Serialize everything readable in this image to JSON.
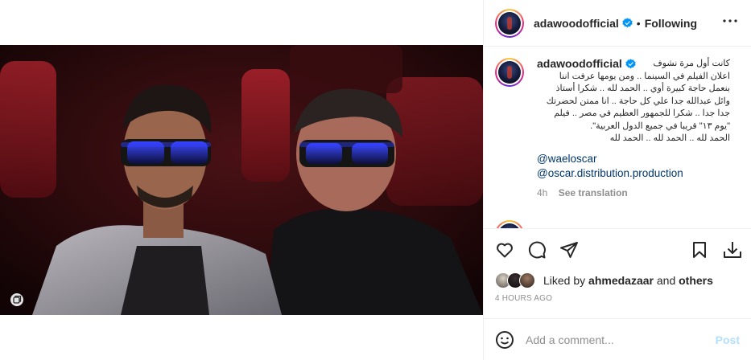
{
  "post": {
    "username": "adawoodofficial",
    "follow_status": "Following",
    "separator": "•"
  },
  "caption": {
    "username": "adawoodofficial",
    "lines": [
      "كانت أول مرة نشوف",
      "اعلان الفيلم في السينما .. ومن يومها عرفت اننا",
      "بنعمل حاجة كبيرة أوي .. الحمد لله .. شكرا أستاذ",
      "وائل عبدالله جدا علي كل حاجة .. انا ممتن لحضرتك",
      "جدا جدا .. شكرا للجمهور العظيم في مصر .. فيلم",
      "\"يوم ١٣\" قريبا في جميع الدول العربية\".",
      "الحمد لله .. الحمد لله .. الحمد لله"
    ],
    "mentions": [
      "@waeloscar",
      "@oscar.distribution.production"
    ],
    "age": "4h",
    "see_translation": "See translation"
  },
  "likes": {
    "prefix": "Liked by",
    "user": "ahmedazaar",
    "and": "and",
    "others": "others"
  },
  "timestamp": "4 HOURS AGO",
  "comment_box": {
    "placeholder": "Add a comment...",
    "post_label": "Post"
  },
  "colors": {
    "verified": "#0095f6",
    "link": "#00376b",
    "post_disabled": "#b2dffc",
    "muted": "#8e8e8e"
  },
  "icons": [
    "more-icon",
    "verified-icon",
    "heart-icon",
    "comment-icon",
    "share-icon",
    "save-icon",
    "download-icon",
    "emoji-icon",
    "multi-image-icon"
  ]
}
